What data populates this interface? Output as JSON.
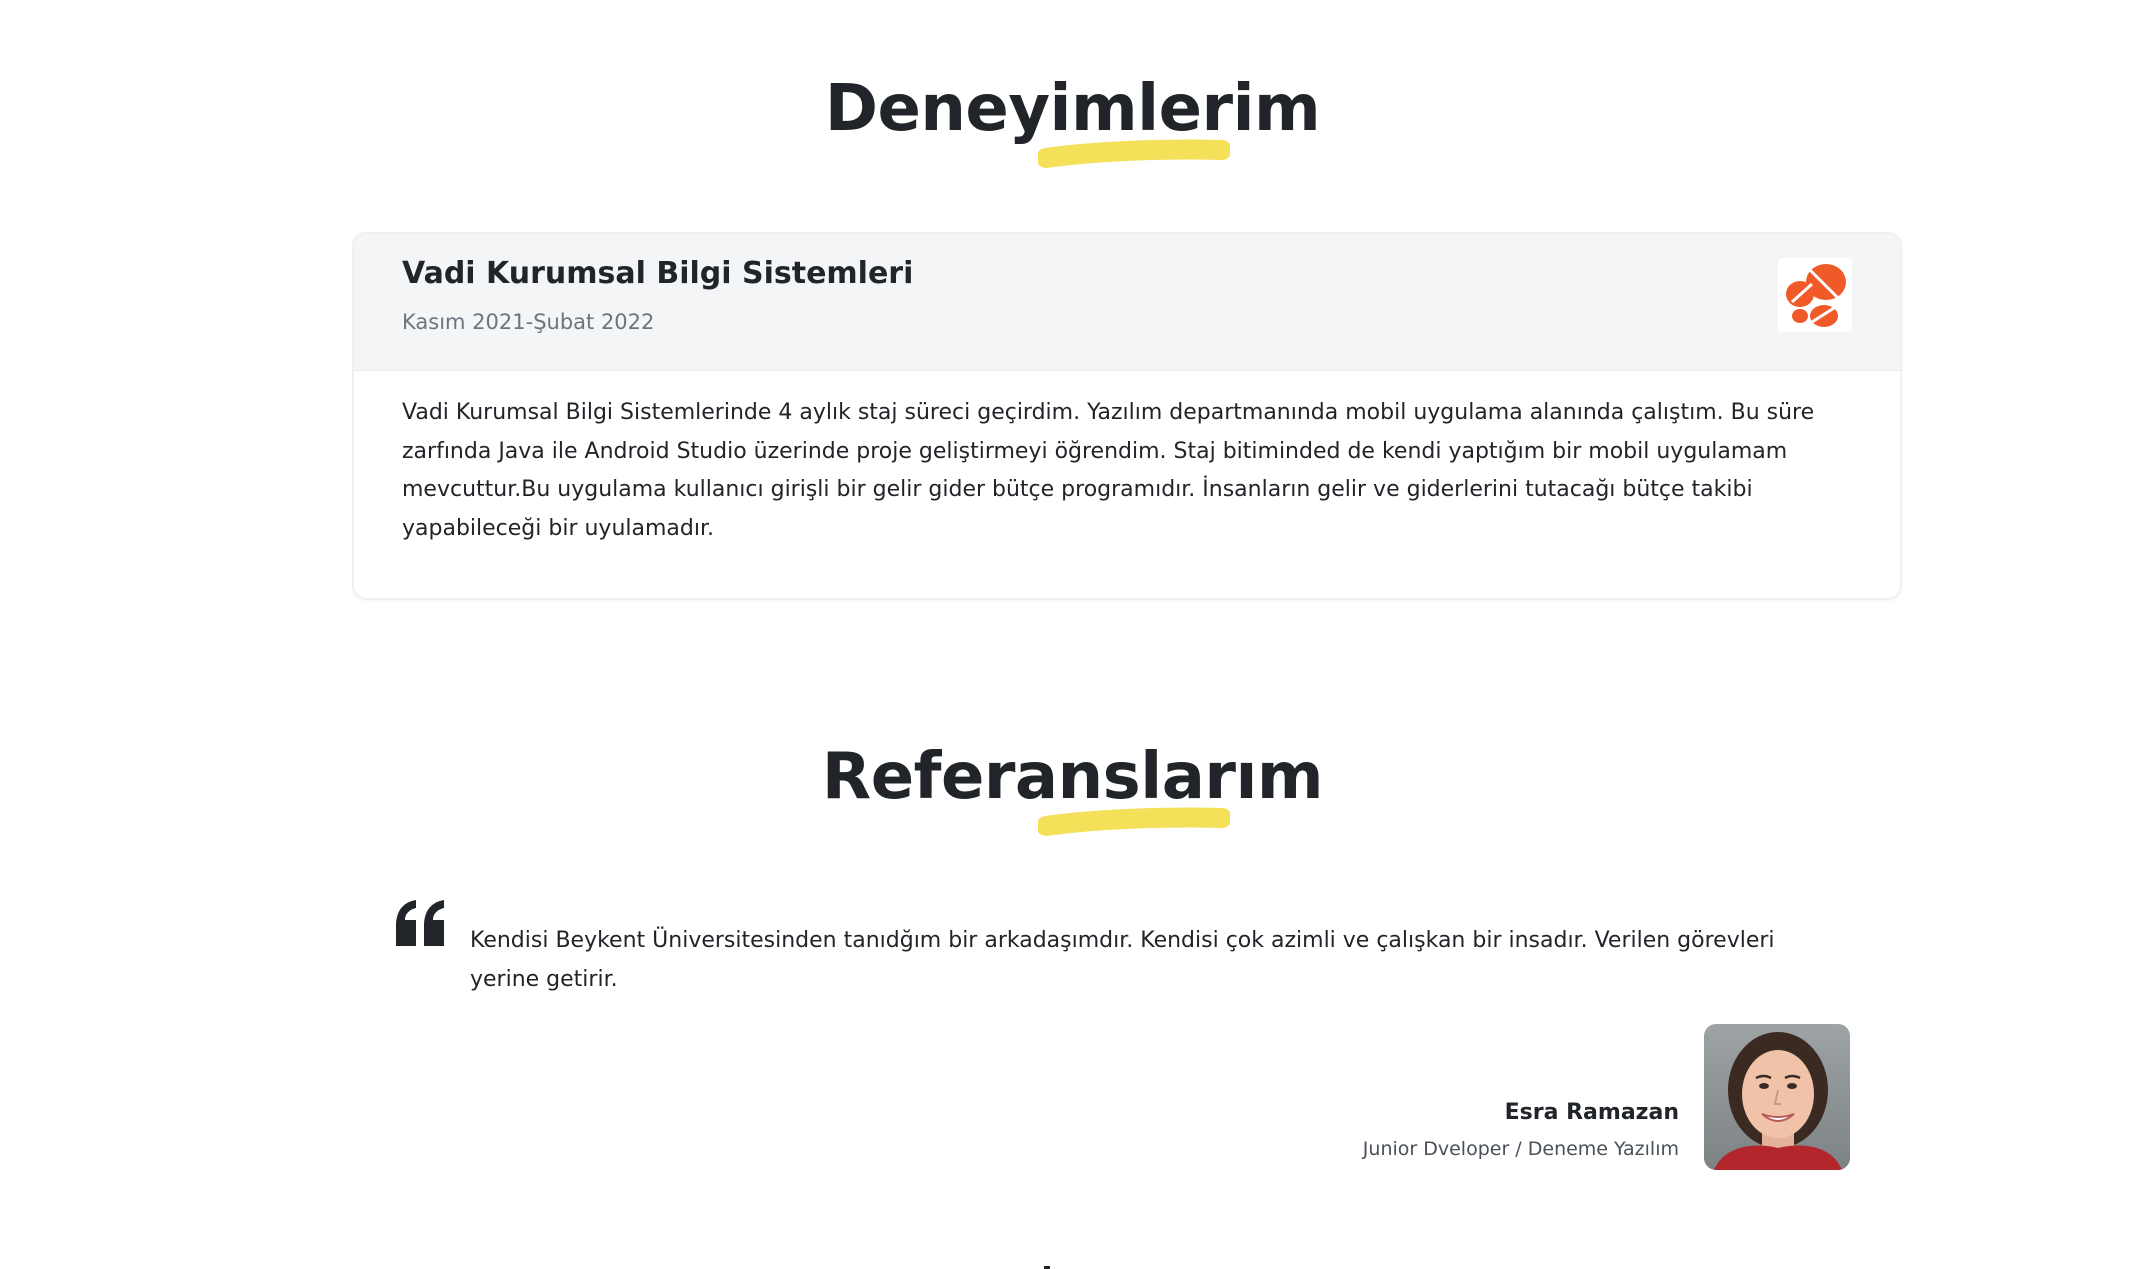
{
  "experience": {
    "heading": "Deneyimlerim",
    "items": [
      {
        "company": "Vadi Kurumsal Bilgi Sistemleri",
        "period": "Kasım 2021-Şubat 2022",
        "logo_icon": "vadi-logo-icon",
        "description": "Vadi Kurumsal Bilgi Sistemlerinde 4 aylık staj süreci geçirdim. Yazılım departmanında mobil uygulama alanında çalıştım. Bu süre zarfında Java ile Android Studio üzerinde proje geliştirmeyi öğrendim. Staj bitiminded de kendi yaptığım bir mobil uygulamam mevcuttur.Bu uygulama kullanıcı girişli bir gelir gider bütçe programıdır. İnsanların gelir ve giderlerini tutacağı bütçe takibi yapabileceği bir uyulamadır."
      }
    ]
  },
  "references": {
    "heading": "Referanslarım",
    "items": [
      {
        "quote": "Kendisi Beykent Üniversitesinden tanıdğım bir arkadaşımdır. Kendisi çok azimli ve çalışkan bir insadır. Verilen görevleri yerine getirir.",
        "name": "Esra Ramazan",
        "role": "Junior Dveloper / Deneme Yazılım",
        "avatar_icon": "avatar-photo"
      }
    ]
  },
  "colors": {
    "accent_yellow": "#f5e05a",
    "logo_orange": "#f05a28",
    "text_dark": "#212529",
    "text_muted": "#6c757d",
    "card_header_bg": "#f4f5f7"
  }
}
